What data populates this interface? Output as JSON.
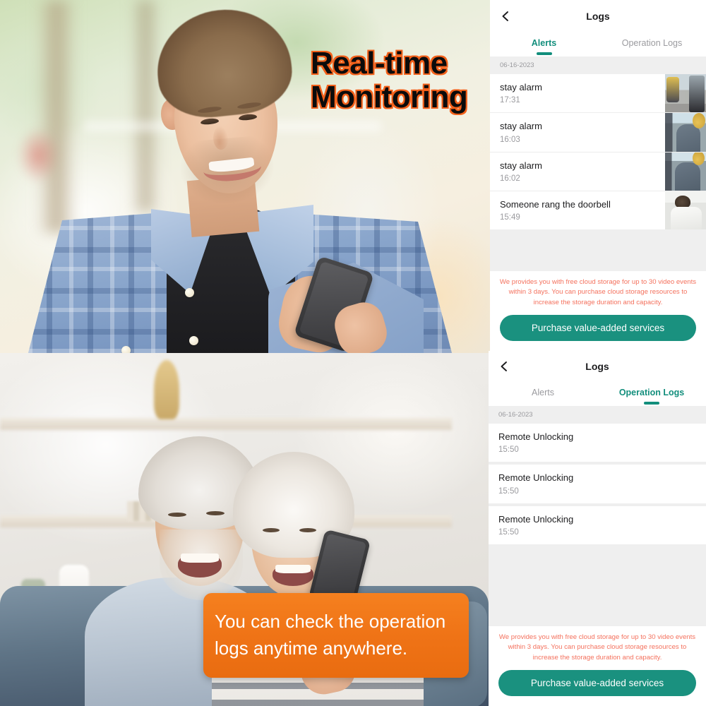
{
  "marketing": {
    "headline_top": "Real-time",
    "headline_bottom": "Monitoring",
    "caption_line1": "You can check the operation",
    "caption_line2": "logs anytime anywhere.",
    "headline_color": "#0b0b0b",
    "headline_outline_color": "#f2601a",
    "caption_bg": "#ef7316",
    "caption_color": "#ffffff"
  },
  "theme": {
    "accent_teal": "#128e7c",
    "button_teal": "#1a917f",
    "promo_coral": "#f4715d",
    "list_bg_grey": "#efefef",
    "muted_text": "#9a9a9e"
  },
  "panel_alerts": {
    "nav": {
      "back_icon": "chevron-left-icon",
      "title": "Logs"
    },
    "tabs": [
      {
        "label": "Alerts",
        "active": true
      },
      {
        "label": "Operation Logs",
        "active": false
      }
    ],
    "date_header": "06-16-2023",
    "rows": [
      {
        "title": "stay alarm",
        "time": "17:31",
        "thumb": "thumbnail-lobby"
      },
      {
        "title": "stay alarm",
        "time": "16:03",
        "thumb": "thumbnail-person-seated"
      },
      {
        "title": "stay alarm",
        "time": "16:02",
        "thumb": "thumbnail-person-seated-2"
      },
      {
        "title": "Someone rang the doorbell",
        "time": "15:49",
        "thumb": "thumbnail-visitor"
      }
    ],
    "promo_text": "We provides you with free cloud storage for up to 30 video events within 3 days. You can purchase cloud storage resources to increase the storage duration and capacity.",
    "cta_label": "Purchase value-added services"
  },
  "panel_operation_logs": {
    "nav": {
      "back_icon": "chevron-left-icon",
      "title": "Logs"
    },
    "tabs": [
      {
        "label": "Alerts",
        "active": false
      },
      {
        "label": "Operation Logs",
        "active": true
      }
    ],
    "date_header": "06-16-2023",
    "rows": [
      {
        "title": "Remote Unlocking",
        "time": "15:50"
      },
      {
        "title": "Remote Unlocking",
        "time": "15:50"
      },
      {
        "title": "Remote Unlocking",
        "time": "15:50"
      }
    ],
    "promo_text": "We provides you with free cloud storage for up to 30 video events within 3 days. You can purchase cloud storage resources to increase the storage duration and capacity.",
    "cta_label": "Purchase value-added services"
  }
}
